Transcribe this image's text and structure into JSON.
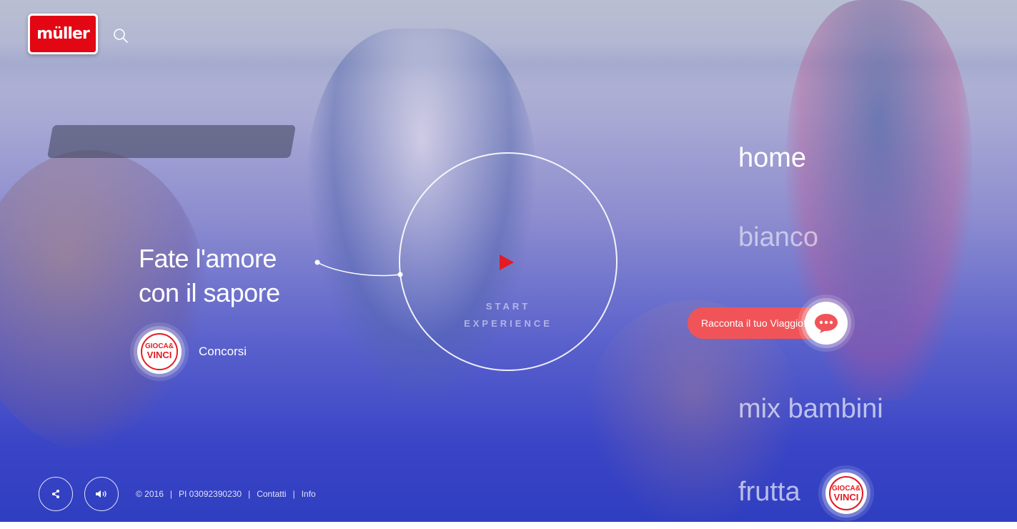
{
  "brand": {
    "logo_text": "müller"
  },
  "hero": {
    "headline_line1": "Fate l'amore",
    "headline_line2": "con il sapore",
    "cta_line1": "START",
    "cta_line2": "EXPERIENCE"
  },
  "promo": {
    "badge_line1": "GIOCA&",
    "badge_line2": "VINCI",
    "label": "Concorsi"
  },
  "nav": {
    "items": [
      {
        "label": "home"
      },
      {
        "label": "bianco"
      },
      {
        "label": "mix bambini"
      },
      {
        "label": "frutta"
      }
    ]
  },
  "chat": {
    "label": "Racconta il tuo Viaggio!"
  },
  "footer": {
    "copyright": "© 2016",
    "vat": "PI 03092390230",
    "contacts": "Contatti",
    "info": "Info",
    "separator": "|"
  },
  "colors": {
    "accent_red": "#e31b23",
    "chat_pill": "#f05458",
    "bg_bottom": "#2f3ec0"
  },
  "icons": [
    "search-icon",
    "play-icon",
    "share-icon",
    "speaker-icon",
    "chat-icon"
  ]
}
